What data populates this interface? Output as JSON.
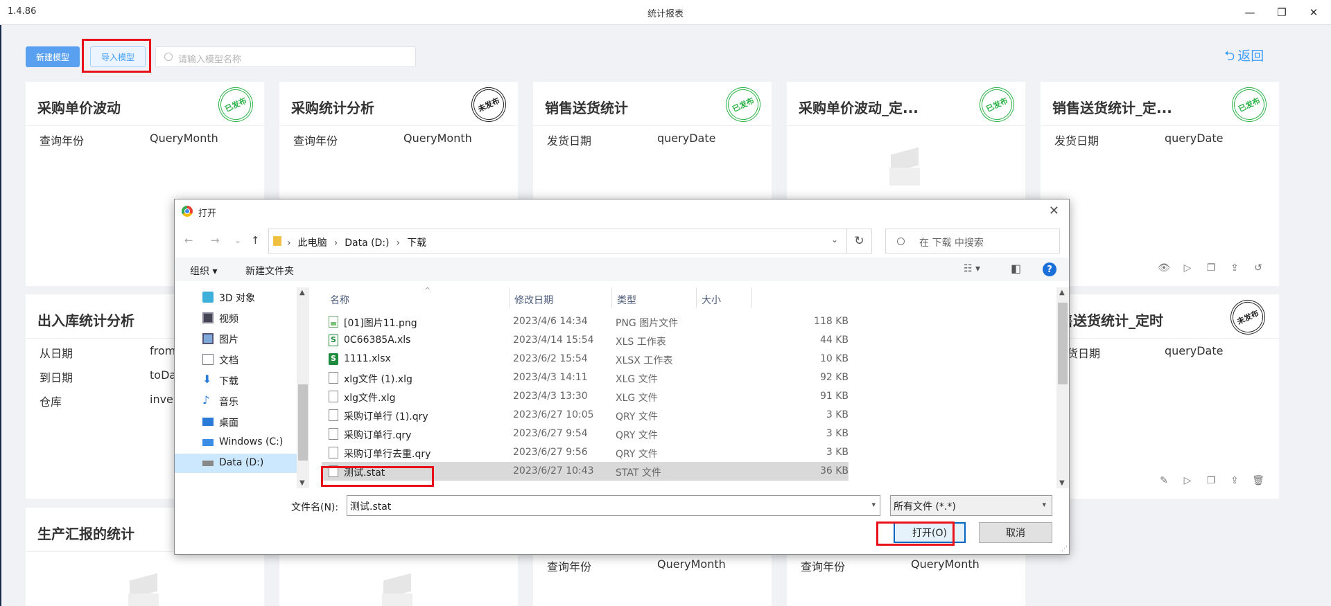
{
  "window": {
    "version": "1.4.86",
    "title": "统计报表",
    "min_glyph": "—",
    "max_glyph": "❐",
    "close_glyph": "✕"
  },
  "toolbar": {
    "new_model_label": "新建模型",
    "import_model_label": "导入模型",
    "search_placeholder": "请输入模型名称",
    "back_label": "返回",
    "back_glyph": "⮌"
  },
  "stamps": {
    "published": "已发布",
    "unpublished": "未发布"
  },
  "cards": [
    {
      "title": "采购单价波动",
      "status": "已发布",
      "params": [
        {
          "k": "查询年份",
          "v": "QueryMonth"
        }
      ]
    },
    {
      "title": "采购统计分析",
      "status": "未发布",
      "params": [
        {
          "k": "查询年份",
          "v": "QueryMonth"
        }
      ]
    },
    {
      "title": "销售送货统计",
      "status": "已发布",
      "params": [
        {
          "k": "发货日期",
          "v": "queryDate"
        }
      ]
    },
    {
      "title": "采购单价波动_定...",
      "status": "已发布",
      "params": []
    },
    {
      "title": "销售送货统计_定...",
      "status": "已发布",
      "params": [
        {
          "k": "发货日期",
          "v": "queryDate"
        }
      ]
    },
    {
      "title": "出入库统计分析",
      "status": "",
      "params": [
        {
          "k": "从日期",
          "v": "fromI"
        },
        {
          "k": "到日期",
          "v": "toDa"
        },
        {
          "k": "仓库",
          "v": "inver"
        }
      ]
    },
    {
      "title": "售送货统计_定时",
      "status": "未发布",
      "params": [
        {
          "k": "货日期",
          "v": "queryDate"
        }
      ]
    },
    {
      "title": "生产汇报的统计",
      "status": "",
      "params": []
    },
    {
      "title": "",
      "status": "",
      "params": [
        {
          "k": "查询年份",
          "v": "QueryMonth"
        }
      ]
    },
    {
      "title": "",
      "status": "",
      "params": [
        {
          "k": "查询年份",
          "v": "QueryMonth"
        }
      ]
    }
  ],
  "card_actions": {
    "view": "👁",
    "run": "▷",
    "copy": "❐",
    "export": "⇪",
    "revert": "↺",
    "edit": "✎",
    "delete": "🗑"
  },
  "dialog": {
    "title": "打开",
    "close_glyph": "✕",
    "back_glyph": "←",
    "forward_glyph": "→",
    "recent_glyph": "⌄",
    "up_glyph": "↑",
    "breadcrumb": [
      "此电脑",
      "Data (D:)",
      "下载"
    ],
    "crumb_sep": "›",
    "refresh_glyph": "↻",
    "search_placeholder": "在 下载 中搜索",
    "organize_label": "组织 ▾",
    "new_folder_label": "新建文件夹",
    "view_glyph": "☷ ▾",
    "preview_glyph": "◧",
    "help_glyph": "?",
    "nav_items": [
      {
        "label": "3D 对象",
        "icon": "cube-icon"
      },
      {
        "label": "视频",
        "icon": "video-icon"
      },
      {
        "label": "图片",
        "icon": "picture-icon"
      },
      {
        "label": "文档",
        "icon": "document-icon"
      },
      {
        "label": "下载",
        "icon": "download-icon"
      },
      {
        "label": "音乐",
        "icon": "music-icon"
      },
      {
        "label": "桌面",
        "icon": "desktop-icon"
      },
      {
        "label": "Windows (C:)",
        "icon": "drive-c-icon"
      },
      {
        "label": "Data (D:)",
        "icon": "drive-d-icon"
      }
    ],
    "columns": {
      "name": "名称",
      "date": "修改日期",
      "type": "类型",
      "size": "大小"
    },
    "files": [
      {
        "name": "[01]图片11.png",
        "date": "2023/4/6 14:34",
        "type": "PNG 图片文件",
        "size": "118 KB",
        "icon": "png"
      },
      {
        "name": "0C66385A.xls",
        "date": "2023/4/14 15:54",
        "type": "XLS 工作表",
        "size": "44 KB",
        "icon": "xls"
      },
      {
        "name": "1111.xlsx",
        "date": "2023/6/2 15:54",
        "type": "XLSX 工作表",
        "size": "10 KB",
        "icon": "xlsx"
      },
      {
        "name": "xlg文件 (1).xlg",
        "date": "2023/4/3 14:11",
        "type": "XLG 文件",
        "size": "92 KB",
        "icon": "file"
      },
      {
        "name": "xlg文件.xlg",
        "date": "2023/4/3 13:30",
        "type": "XLG 文件",
        "size": "91 KB",
        "icon": "file"
      },
      {
        "name": "采购订单行 (1).qry",
        "date": "2023/6/27 10:05",
        "type": "QRY 文件",
        "size": "3 KB",
        "icon": "file"
      },
      {
        "name": "采购订单行.qry",
        "date": "2023/6/27 9:54",
        "type": "QRY 文件",
        "size": "3 KB",
        "icon": "file"
      },
      {
        "name": "采购订单行去重.qry",
        "date": "2023/6/27 9:56",
        "type": "QRY 文件",
        "size": "3 KB",
        "icon": "file"
      },
      {
        "name": "测试.stat",
        "date": "2023/6/27 10:43",
        "type": "STAT 文件",
        "size": "36 KB",
        "icon": "file"
      }
    ],
    "selected_index": 8,
    "filename_label": "文件名(N):",
    "filename_value": "测试.stat",
    "filetype_value": "所有文件 (*.*)",
    "open_label": "打开(O)",
    "cancel_label": "取消"
  },
  "colors": {
    "primary": "#409eff",
    "highlight": "#e8111a",
    "published": "#2db34a"
  }
}
